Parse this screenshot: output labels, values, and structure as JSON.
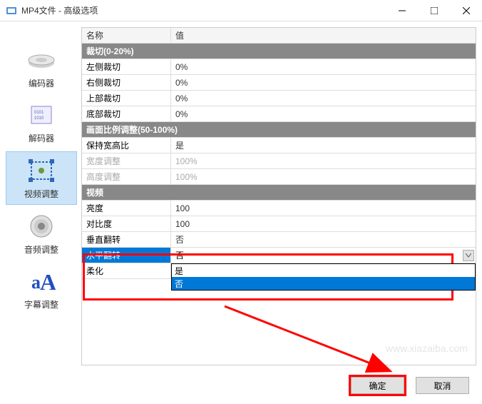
{
  "window": {
    "title": "MP4文件 - 高级选项"
  },
  "sidebar": {
    "items": [
      {
        "label": "编码器"
      },
      {
        "label": "解码器"
      },
      {
        "label": "视频调整"
      },
      {
        "label": "音频调整"
      },
      {
        "label": "字幕调整"
      }
    ]
  },
  "grid": {
    "header": {
      "name": "名称",
      "value": "值"
    },
    "sections": [
      {
        "title": "裁切(0-20%)",
        "rows": [
          {
            "name": "左侧裁切",
            "value": "0%"
          },
          {
            "name": "右侧裁切",
            "value": "0%"
          },
          {
            "name": "上部裁切",
            "value": "0%"
          },
          {
            "name": "底部裁切",
            "value": "0%"
          }
        ]
      },
      {
        "title": "画面比例调整(50-100%)",
        "rows": [
          {
            "name": "保持宽高比",
            "value": "是"
          },
          {
            "name": "宽度调整",
            "value": "100%",
            "disabled": true
          },
          {
            "name": "高度调整",
            "value": "100%",
            "disabled": true
          }
        ]
      },
      {
        "title": "视频",
        "rows": [
          {
            "name": "亮度",
            "value": "100"
          },
          {
            "name": "对比度",
            "value": "100"
          },
          {
            "name": "垂直翻转",
            "value": "否"
          },
          {
            "name": "水平翻转",
            "value": "否",
            "selected": true
          },
          {
            "name": "柔化",
            "value": ""
          }
        ]
      }
    ]
  },
  "dropdown": {
    "options": [
      {
        "label": "是"
      },
      {
        "label": "否",
        "hover": true
      }
    ]
  },
  "footer": {
    "ok": "确定",
    "cancel": "取消"
  },
  "watermark": "www.xiazaiba.com"
}
